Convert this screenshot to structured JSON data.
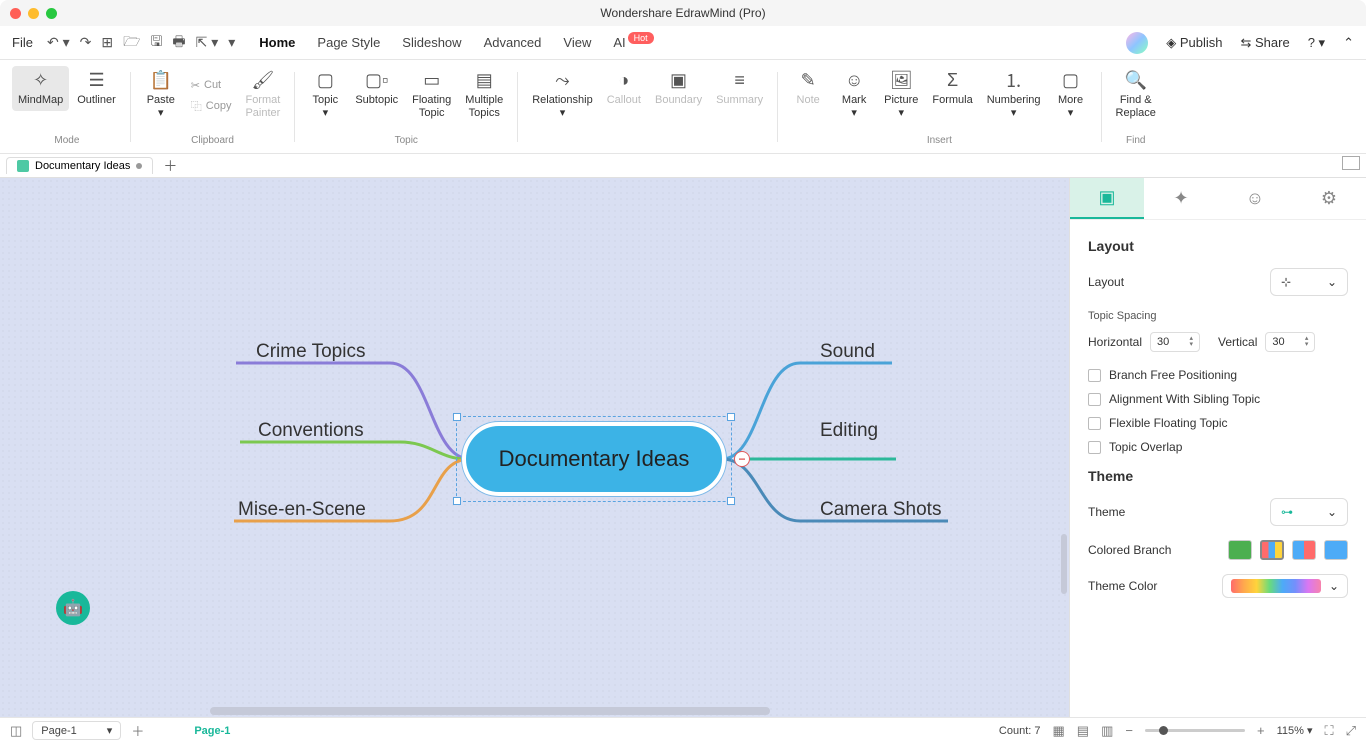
{
  "window_title": "Wondershare EdrawMind (Pro)",
  "menu": {
    "file": "File",
    "tabs": [
      "Home",
      "Page Style",
      "Slideshow",
      "Advanced",
      "View",
      "AI"
    ],
    "active_tab": "Home",
    "hot_badge": "Hot",
    "publish": "Publish",
    "share": "Share"
  },
  "ribbon": {
    "mindmap": "MindMap",
    "outliner": "Outliner",
    "mode_label": "Mode",
    "paste": "Paste",
    "cut": "Cut",
    "copy": "Copy",
    "format_painter": "Format\nPainter",
    "clipboard_label": "Clipboard",
    "topic": "Topic",
    "subtopic": "Subtopic",
    "floating_topic": "Floating\nTopic",
    "multiple_topics": "Multiple\nTopics",
    "topic_label": "Topic",
    "relationship": "Relationship",
    "callout": "Callout",
    "boundary": "Boundary",
    "summary": "Summary",
    "note": "Note",
    "mark": "Mark",
    "picture": "Picture",
    "formula": "Formula",
    "numbering": "Numbering",
    "more": "More",
    "insert_label": "Insert",
    "find_replace": "Find &\nReplace",
    "find_label": "Find"
  },
  "doc": {
    "name": "Documentary Ideas"
  },
  "mindmap": {
    "central": "Documentary Ideas",
    "left": [
      "Crime Topics",
      "Conventions",
      "Mise-en-Scene"
    ],
    "right": [
      "Sound",
      "Editing",
      "Camera Shots"
    ]
  },
  "rpanel": {
    "layout": "Layout",
    "layout_label": "Layout",
    "topic_spacing": "Topic Spacing",
    "horizontal": "Horizontal",
    "vertical": "Vertical",
    "h_val": "30",
    "v_val": "30",
    "chk1": "Branch Free Positioning",
    "chk2": "Alignment With Sibling Topic",
    "chk3": "Flexible Floating Topic",
    "chk4": "Topic Overlap",
    "theme": "Theme",
    "theme_label": "Theme",
    "colored_branch": "Colored Branch",
    "theme_color": "Theme Color"
  },
  "status": {
    "page_sel": "Page-1",
    "page_tab": "Page-1",
    "count": "Count: 7",
    "zoom": "115%"
  }
}
